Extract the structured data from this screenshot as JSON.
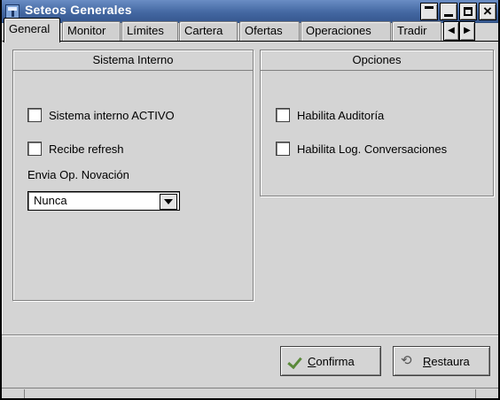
{
  "window": {
    "title": "Seteos Generales",
    "controls": [
      "minimize",
      "restore",
      "maximize",
      "close"
    ],
    "close_glyph": "×"
  },
  "tabs": [
    {
      "label": "General",
      "active": true
    },
    {
      "label": "Monitor",
      "active": false
    },
    {
      "label": "Límites",
      "active": false
    },
    {
      "label": "Cartera",
      "active": false
    },
    {
      "label": "Ofertas",
      "active": false
    },
    {
      "label": "Operaciones",
      "active": false
    },
    {
      "label": "Tradir",
      "active": false
    }
  ],
  "tab_scroll": {
    "left": "◀",
    "right": "▶"
  },
  "sistema_interno": {
    "title": "Sistema Interno",
    "checkboxes": [
      {
        "label": "Sistema interno ACTIVO",
        "checked": false
      },
      {
        "label": "Recibe refresh",
        "checked": false
      }
    ],
    "novacion_label": "Envia Op. Novación",
    "novacion_value": "Nunca"
  },
  "opciones": {
    "title": "Opciones",
    "checkboxes": [
      {
        "label": "Habilita Auditoría",
        "checked": false
      },
      {
        "label": "Habilita Log. Conversaciones",
        "checked": false
      }
    ]
  },
  "buttons": {
    "confirma": {
      "underlined": "C",
      "rest": "onfirma"
    },
    "restaura": {
      "underlined": "R",
      "rest": "estaura"
    }
  },
  "colors": {
    "titlebar": "#4d71a8",
    "panel": "#d4d4d4",
    "confirm_check": "#5a8a3a"
  }
}
